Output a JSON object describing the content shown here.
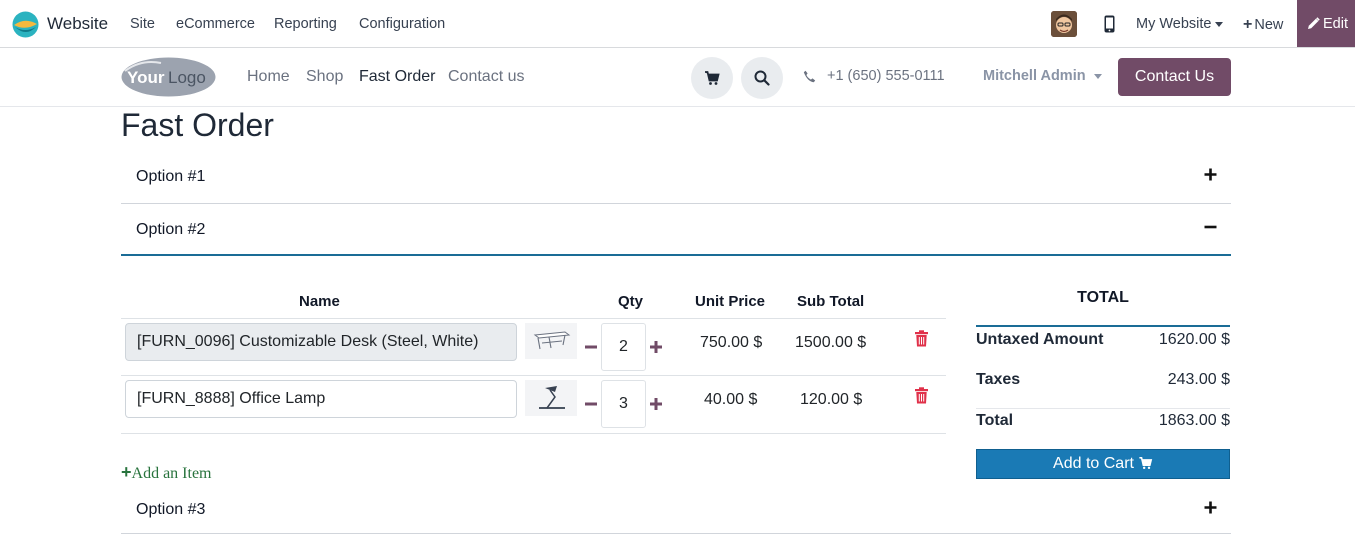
{
  "topbar": {
    "app_name": "Website",
    "menu": [
      "Site",
      "eCommerce",
      "Reporting",
      "Configuration"
    ],
    "website_selector": "My Website",
    "new_label": "New",
    "edit_label": "Edit",
    "icons": [
      "odoo-logo-icon",
      "avatar",
      "mobile-preview-icon",
      "caret-down-icon",
      "plus-icon",
      "pencil-icon"
    ]
  },
  "site_header": {
    "logo_text": "YourLogo",
    "nav": [
      "Home",
      "Shop",
      "Fast Order",
      "Contact us"
    ],
    "active_nav": "Fast Order",
    "phone": "+1 (650) 555-0111",
    "user": "Mitchell Admin",
    "contact_button": "Contact Us"
  },
  "page": {
    "title": "Fast Order",
    "options": [
      {
        "label": "Option #1",
        "expanded": false
      },
      {
        "label": "Option #2",
        "expanded": true
      },
      {
        "label": "Option #3",
        "expanded": false
      }
    ]
  },
  "order_table": {
    "headers": {
      "name": "Name",
      "qty": "Qty",
      "unit_price": "Unit Price",
      "sub_total": "Sub Total"
    },
    "rows": [
      {
        "product": "[FURN_0096] Customizable Desk (Steel, White)",
        "qty": "2",
        "unit_price": "750.00 $",
        "sub_total": "1500.00 $"
      },
      {
        "product": "[FURN_8888] Office Lamp",
        "qty": "3",
        "unit_price": "40.00 $",
        "sub_total": "120.00 $"
      }
    ],
    "add_item_label": "Add an Item"
  },
  "totals": {
    "heading": "TOTAL",
    "untaxed_label": "Untaxed Amount",
    "untaxed_value": "1620.00 $",
    "taxes_label": "Taxes",
    "taxes_value": "243.00 $",
    "total_label": "Total",
    "total_value": "1863.00 $",
    "add_to_cart_label": "Add to Cart"
  },
  "colors": {
    "brand": "#714b67",
    "accent_blue": "#1a6c96",
    "cart_button": "#1a7ab5",
    "add_item_green": "#28733d",
    "trash_red": "#e0314a"
  }
}
